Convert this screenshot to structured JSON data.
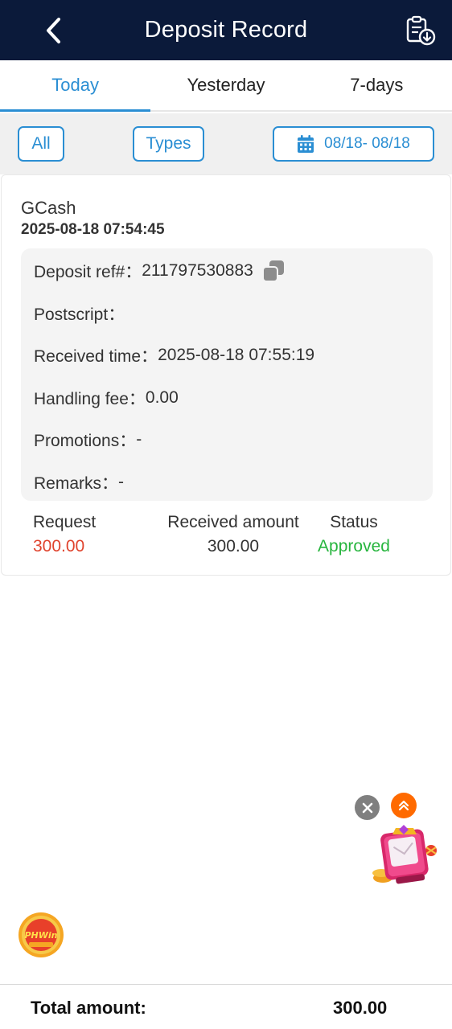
{
  "header": {
    "title": "Deposit Record",
    "back_icon": "chevron-left-icon",
    "export_icon": "clipboard-download-icon"
  },
  "tabs": [
    {
      "label": "Today",
      "active": true
    },
    {
      "label": "Yesterday",
      "active": false
    },
    {
      "label": "7-days",
      "active": false
    }
  ],
  "filters": {
    "all_label": "All",
    "types_label": "Types",
    "date_range": "08/18- 08/18",
    "date_icon": "calendar-icon"
  },
  "record": {
    "method": "GCash",
    "datetime": "2025-08-18 07:54:45",
    "details": {
      "ref_label": "Deposit ref#：",
      "ref_value": "211797530883",
      "postscript_label": "Postscript：",
      "postscript_value": "",
      "received_time_label": "Received time：",
      "received_time_value": "2025-08-18 07:55:19",
      "handling_fee_label": "Handling fee：",
      "handling_fee_value": "0.00",
      "promotions_label": "Promotions：",
      "promotions_value": "-",
      "remarks_label": "Remarks：",
      "remarks_value": "-"
    },
    "summary": {
      "request_label": "Request",
      "request_value": "300.00",
      "received_label": "Received amount",
      "received_value": "300.00",
      "status_label": "Status",
      "status_value": "Approved"
    }
  },
  "footer": {
    "total_label": "Total amount:",
    "total_value": "300.00"
  },
  "colors": {
    "header_bg": "#0b1a3a",
    "accent": "#2a8ed3",
    "request_red": "#e0442e",
    "approved_green": "#27b53e"
  }
}
